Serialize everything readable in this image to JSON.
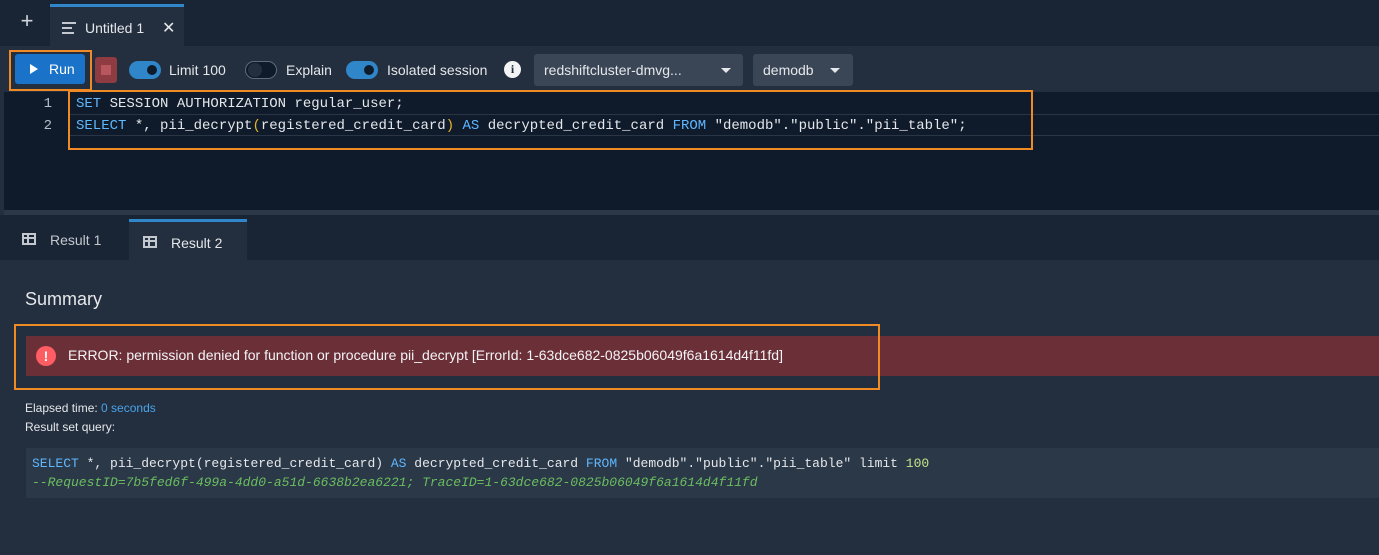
{
  "tabbar": {
    "new_tab_icon": "+",
    "editor_tab": {
      "label": "Untitled 1",
      "close_icon": "✕"
    }
  },
  "toolbar": {
    "run_label": "Run",
    "limit": {
      "label": "Limit 100",
      "on": true
    },
    "explain": {
      "label": "Explain",
      "on": false
    },
    "isolated_session": {
      "label": "Isolated session",
      "on": true
    },
    "info_icon": "i",
    "connection_select": "redshiftcluster-dmvg...",
    "database_select": "demodb"
  },
  "editor": {
    "line_numbers": [
      "1",
      "2"
    ],
    "line1": {
      "kw": "SET",
      "rest": " SESSION AUTHORIZATION regular_user;"
    },
    "line2": {
      "kw_select": "SELECT",
      "part1": " *, pii_decrypt",
      "paren_open": "(",
      "arg": "registered_credit_card",
      "paren_close": ")",
      "space1": " ",
      "kw_as": "AS",
      "part2": " decrypted_credit_card ",
      "kw_from": "FROM",
      "part3": " \"demodb\".\"public\".\"pii_table\";"
    }
  },
  "results": {
    "tabs": [
      {
        "label": "Result 1",
        "active": false
      },
      {
        "label": "Result 2",
        "active": true
      }
    ],
    "summary_title": "Summary",
    "error_icon": "!",
    "error_text": "ERROR: permission denied for function or procedure pii_decrypt [ErrorId: 1-63dce682-0825b06049f6a1614d4f11fd]",
    "elapsed_label": "Elapsed time:",
    "elapsed_value": "0 seconds",
    "result_set_label": "Result set query:",
    "query": {
      "kw_select": "SELECT",
      "part1": " *, pii_decrypt(registered_credit_card) ",
      "kw_as": "AS",
      "part2": " decrypted_credit_card ",
      "kw_from": "FROM",
      "part3": " \"demodb\".\"public\".\"pii_table\" limit ",
      "limit_value": "100",
      "comment": "--RequestID=7b5fed6f-499a-4dd0-a51d-6638b2ea6221; TraceID=1-63dce682-0825b06049f6a1614d4f11fd"
    }
  },
  "colors": {
    "highlight": "#f08a24",
    "accent": "#2f86c9",
    "error_bg": "#6b2f38"
  }
}
